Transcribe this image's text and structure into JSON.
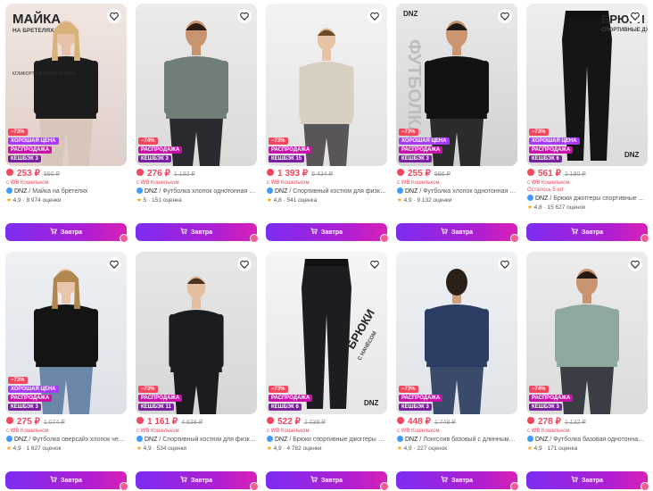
{
  "button_label": "Завтра",
  "wallet_label": "с WB Кошельком",
  "cards": [
    {
      "discount": "−73%",
      "good_price": "ХОРОШАЯ ЦЕНА",
      "sale": "РАСПРОДАЖА",
      "cashback": "КЕШБЭК 3",
      "price": "253 ₽",
      "old_price": "990 ₽",
      "brand": "DNZ",
      "title": "/ Майка на бретелях",
      "rating": "4,9",
      "reviews": "8 974 оценки",
      "overlay_title": "МАЙКА",
      "overlay_sub": "НА БРЕТЕЛЯХ",
      "overlay_note": "КОМФОРТ НА КАЖДЫЙ ДЕНЬ"
    },
    {
      "discount": "−74%",
      "sale": "РАСПРОДАЖА",
      "cashback": "КЕШБЭК 3",
      "price": "276 ₽",
      "old_price": "1 132 ₽",
      "brand": "DNZ",
      "title": "/ Футболка хлопок однотонная л...",
      "rating": "5",
      "reviews": "151 оценка"
    },
    {
      "discount": "−73%",
      "sale": "РАСПРОДАЖА",
      "cashback": "КЕШБЭК 15",
      "price": "1 393 ₽",
      "old_price": "5 434 ₽",
      "brand": "DNZ",
      "title": "/ Спортивный костюм для физку...",
      "rating": "4,8",
      "reviews": "541 оценка"
    },
    {
      "discount": "−73%",
      "good_price": "ХОРОШАЯ ЦЕНА",
      "sale": "РАСПРОДАЖА",
      "cashback": "КЕШБЭК 3",
      "price": "255 ₽",
      "old_price": "996 ₽",
      "brand": "DNZ",
      "title": "/ Футболка хлопок однотонная л...",
      "rating": "4,9",
      "reviews": "9 132 оценки",
      "overlay_title": "ФУТБОЛКА",
      "overlay_logo": "DNZ"
    },
    {
      "discount": "−73%",
      "good_price": "ХОРОШАЯ ЦЕНА",
      "sale": "РАСПРОДАЖА",
      "cashback": "КЕШБЭК 6",
      "price": "561 ₽",
      "old_price": "2 190 ₽",
      "stock": "Осталось 5 шт",
      "brand": "DNZ",
      "title": "/ Брюки джоггеры спортивные н...",
      "rating": "4,8",
      "reviews": "15 627 оценок",
      "overlay_title": "БРЮКИ",
      "overlay_sub": "СПОРТИВНЫЕ ДЖОГГЕРЫ",
      "overlay_logo": "DNZ"
    },
    {
      "discount": "−73%",
      "good_price": "ХОРОШАЯ ЦЕНА",
      "sale": "РАСПРОДАЖА",
      "cashback": "КЕШБЭК 3",
      "price": "275 ₽",
      "old_price": "1 074 ₽",
      "brand": "DNZ",
      "title": "/ Футболка оверсайз хлопок чер...",
      "rating": "4,9",
      "reviews": "1 627 оценок"
    },
    {
      "discount": "−73%",
      "sale": "РАСПРОДАЖА",
      "cashback": "КЕШБЭК 11",
      "price": "1 161 ₽",
      "old_price": "4 638 ₽",
      "brand": "DNZ",
      "title": "/ Спортивный костюм для физку...",
      "rating": "4,9",
      "reviews": "534 оценки"
    },
    {
      "discount": "−73%",
      "sale": "РАСПРОДАЖА",
      "cashback": "КЕШБЭК 6",
      "price": "522 ₽",
      "old_price": "2 038 ₽",
      "brand": "DNZ",
      "title": "/ Брюки спортивные джоггеры с...",
      "rating": "4,9",
      "reviews": "4 782 оценки",
      "overlay_title": "БРЮКИ",
      "overlay_sub": "С НАЧЁСОМ",
      "overlay_logo": "DNZ"
    },
    {
      "discount": "−73%",
      "sale": "РАСПРОДАЖА",
      "cashback": "КЕШБЭК 3",
      "price": "448 ₽",
      "old_price": "1 748 ₽",
      "brand": "DNZ",
      "title": "/ Лонгслив базовый с длинным р...",
      "rating": "4,9",
      "reviews": "227 оценок"
    },
    {
      "discount": "−74%",
      "sale": "РАСПРОДАЖА",
      "cashback": "КЕШБЭК 3",
      "price": "278 ₽",
      "old_price": "1 132 ₽",
      "brand": "DNZ",
      "title": "/ Футболка базовая однотонная ...",
      "rating": "4,9",
      "reviews": "171 оценка"
    }
  ],
  "colors": {
    "accent": "#cb11ab",
    "price": "#f5455c",
    "button_start": "#7c2cf2",
    "button_end": "#d920b6"
  }
}
